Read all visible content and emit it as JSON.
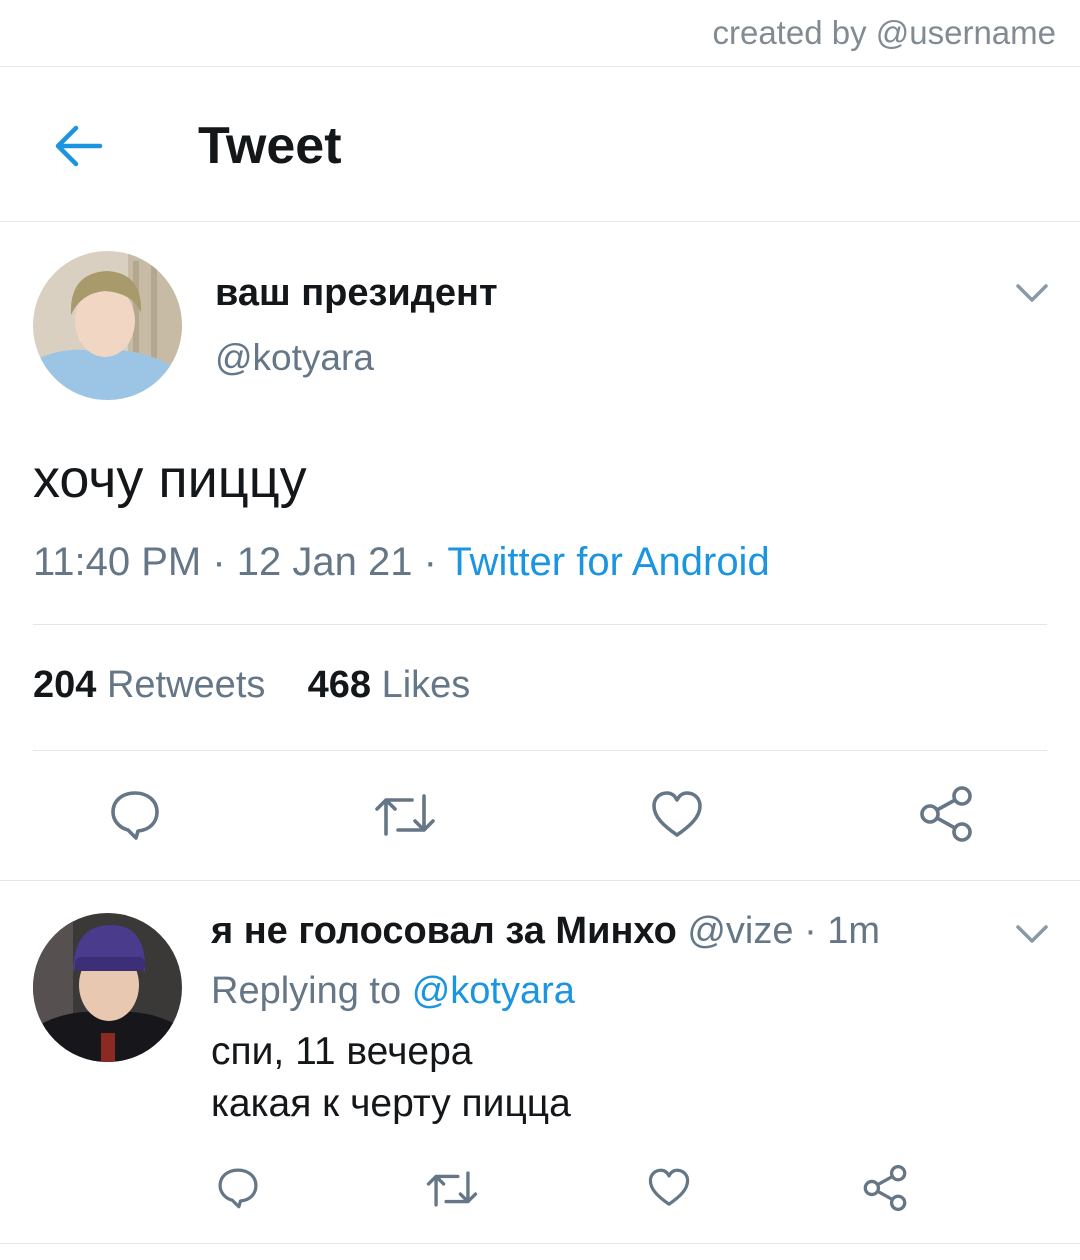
{
  "credit": "created by @username",
  "header": {
    "title": "Tweet"
  },
  "tweet": {
    "display_name": "ваш президент",
    "handle": "@kotyara",
    "text": "хочу пиццу",
    "time": "11:40 PM",
    "separator": " · ",
    "date": "12 Jan 21",
    "source": "Twitter for Android",
    "retweets_count": "204",
    "retweets_label": "Retweets",
    "likes_count": "468",
    "likes_label": "Likes"
  },
  "reply": {
    "display_name": "я не голосовал за Минхо",
    "handle": "@vize",
    "separator": " · ",
    "age": "1m",
    "replying_label": "Replying to",
    "replying_handle": "@kotyara",
    "line1": "спи, 11 вечера",
    "line2": "какая к черту пицца"
  },
  "icons": {
    "back": "arrow-left-icon",
    "menu": "chevron-down-icon",
    "reply": "speech-bubble-icon",
    "retweet": "retweet-icon",
    "like": "heart-icon",
    "share": "share-icon"
  },
  "colors": {
    "accent": "#1b95e0",
    "text_primary": "#14171a",
    "text_secondary": "#657786",
    "divider": "#e1e8ed"
  }
}
